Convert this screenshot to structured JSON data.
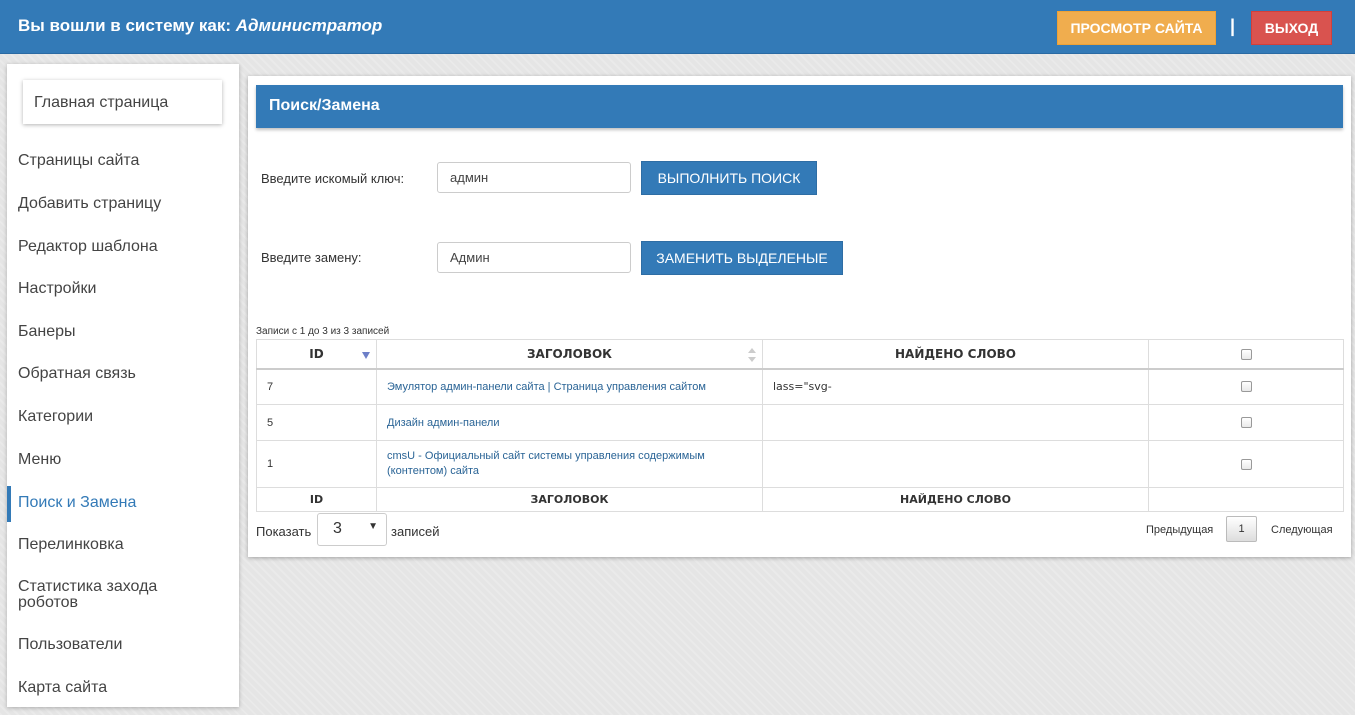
{
  "header": {
    "welcome_prefix": "Вы вошли в систему как:",
    "role": "Администратор",
    "view_site": "Просмотр сайта",
    "separator": "|",
    "logout": "Выход"
  },
  "sidebar": {
    "home": "Главная страница",
    "items": [
      {
        "label": "Страницы сайта"
      },
      {
        "label": "Добавить страницу"
      },
      {
        "label": "Редактор шаблона"
      },
      {
        "label": "Настройки"
      },
      {
        "label": "Банеры"
      },
      {
        "label": "Обратная связь"
      },
      {
        "label": "Категории"
      },
      {
        "label": "Меню"
      },
      {
        "label": "Поиск и Замена"
      },
      {
        "label": "Перелинковка"
      },
      {
        "label": "Статистика захода роботов"
      },
      {
        "label": "Пользователи"
      },
      {
        "label": "Карта сайта"
      }
    ],
    "active_index": 8
  },
  "main": {
    "title": "Поиск/Замена",
    "search_label": "Введите искомый ключ:",
    "search_value": "админ",
    "search_button": "Выполнить поиск",
    "replace_label": "Введите замену:",
    "replace_value": "Админ",
    "replace_button": "Заменить выделеные",
    "records_info": "Записи с 1 до 3 из 3 записей",
    "columns": [
      "ID",
      "ЗАГОЛОВОК",
      "НАЙДЕНО СЛОВО"
    ],
    "rows": [
      {
        "id": "7",
        "title": "Эмулятор админ-панели сайта | Страница управления сайтом",
        "found": "lass=\"svg-"
      },
      {
        "id": "5",
        "title": "Дизайн админ-панели",
        "found": ""
      },
      {
        "id": "1",
        "title": "cmsU - Официальный сайт системы управления содержимым (контентом) сайта",
        "found": ""
      }
    ],
    "show_label": "Показать",
    "page_size": "3",
    "records_label": "записей",
    "prev": "Предыдущая",
    "current_page": "1",
    "next": "Следующая"
  },
  "colors": {
    "primary": "#337ab7",
    "warning": "#f0ad4e",
    "danger": "#d9534f"
  }
}
